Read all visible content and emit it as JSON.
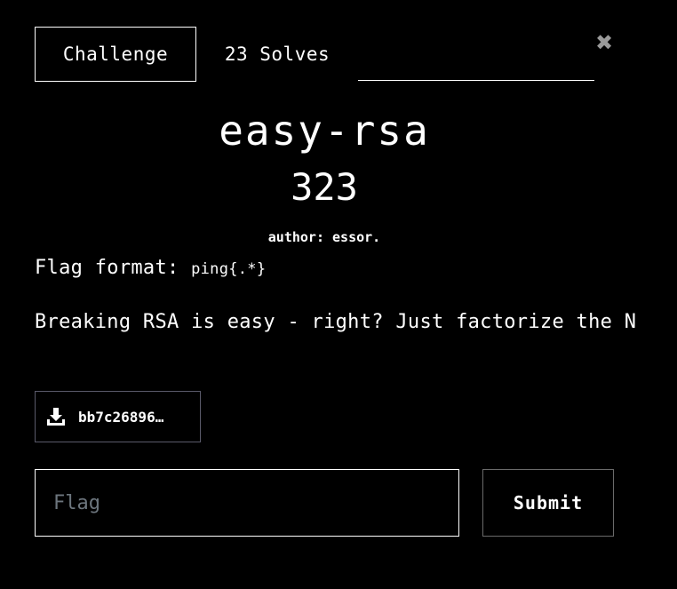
{
  "tabs": {
    "challenge_label": "Challenge",
    "solves_label": "23 Solves"
  },
  "close": {
    "icon": "close-icon",
    "glyph": "✖"
  },
  "challenge": {
    "name": "easy-rsa",
    "value": "323",
    "author": "author: essor.",
    "flag_format_prefix": "Flag format: ",
    "flag_format_code": "ping{.*}",
    "description": "Breaking RSA is easy - right? Just factorize the N"
  },
  "file": {
    "icon": "download-icon",
    "name": "bb7c26896…"
  },
  "submission": {
    "placeholder": "Flag",
    "value": "",
    "submit_label": "Submit"
  },
  "colors": {
    "background": "#000000",
    "text": "#ffffff",
    "placeholder": "#6c757d",
    "close_icon": "#9a9a9a"
  }
}
